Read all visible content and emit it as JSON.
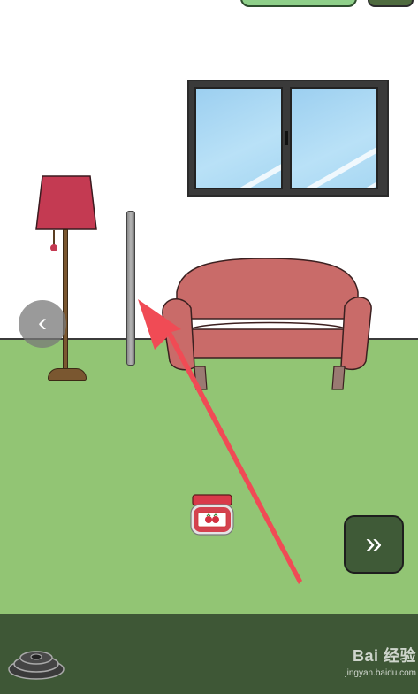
{
  "scene": {
    "objects": [
      "floor-lamp",
      "metal-pole",
      "pink-sofa",
      "window",
      "strawberry-jam-jar",
      "weight-plates"
    ]
  },
  "navigation": {
    "back_symbol": "‹",
    "next_symbol": "»"
  },
  "colors": {
    "wall": "#ffffff",
    "floor": "#92c574",
    "bottom_bar": "#3e5736",
    "sofa": "#c96b69",
    "lamp_shade": "#c43a52",
    "arrow": "#f04b55"
  },
  "watermark": {
    "logo": "Bai 经验",
    "url": "jingyan.baidu.com"
  }
}
